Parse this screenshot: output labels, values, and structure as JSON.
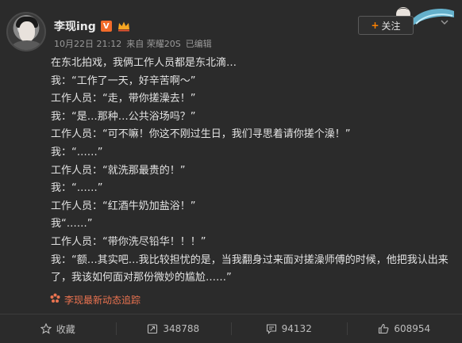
{
  "header": {
    "username": "李现ing",
    "verified_badge": "V",
    "member_icon": "vip-crown-icon",
    "timestamp": "10月22日 21:12",
    "source": "来自 荣耀20S",
    "edited": "已编辑",
    "follow_label": "关注"
  },
  "post": {
    "lines": [
      "在东北拍戏，我俩工作人员都是东北滴…",
      "我：“工作了一天，好辛苦啊～”",
      "工作人员：“走，带你搓澡去！”",
      "我：“是…那种…公共浴场吗？”",
      "工作人员：“可不嘛！你这不刚过生日，我们寻思着请你搓个澡！”",
      "我：“……”",
      "工作人员：“就洗那最贵的！”",
      "我：“……”",
      "工作人员：“红酒牛奶加盐浴！”",
      "我“……”",
      "工作人员：“带你洗尽铅华！！！”",
      "我：“额…其实吧…我比较担忧的是，当我翻身过来面对搓澡师傅的时候，他把我认出来了，我该如何面对那份微妙的尴尬……”"
    ],
    "trace_label": "李现最新动态追踪"
  },
  "actions": {
    "favorite_label": "收藏",
    "repost_count": "348788",
    "comment_count": "94132",
    "like_count": "608954"
  },
  "colors": {
    "background": "#2b2b2b",
    "accent_orange": "#ff8200",
    "trace_color": "#eb7350",
    "text": "#e3e3e3",
    "muted": "#9a9a9a"
  }
}
